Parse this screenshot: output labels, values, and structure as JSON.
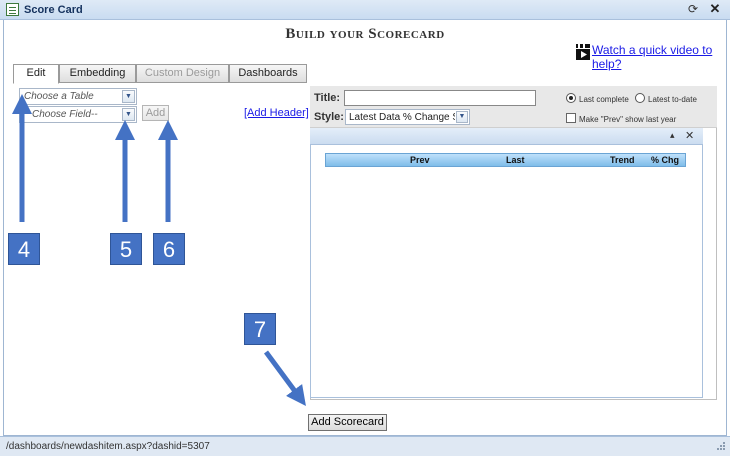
{
  "window": {
    "title": "Score Card",
    "refresh_icon": "refresh-icon",
    "close_icon": "close-icon"
  },
  "page": {
    "heading": "Build your Scorecard"
  },
  "help": {
    "video_link": "Watch a quick video to help?",
    "icon": "clapperboard-icon"
  },
  "tabs": [
    {
      "label": "Edit",
      "active": true,
      "disabled": false
    },
    {
      "label": "Embedding",
      "active": false,
      "disabled": false
    },
    {
      "label": "Custom Design",
      "active": false,
      "disabled": true
    },
    {
      "label": "Dashboards",
      "active": false,
      "disabled": false
    }
  ],
  "editor": {
    "table_placeholder": "Choose a Table",
    "field_placeholder": "Choose Field--",
    "add_label": "Add",
    "add_header_link": "[Add Header]"
  },
  "settings": {
    "title_label": "Title:",
    "title_value": "",
    "style_label": "Style:",
    "style_value": "Latest Data % Change Sc",
    "radio_last_complete": "Last complete",
    "radio_last_todate": "Latest to-date",
    "selected_radio": "Last complete",
    "checkbox_label": "Make \"Prev\" show last year",
    "checkbox_checked": false
  },
  "preview": {
    "minimize_glyph": "▴",
    "close_glyph": "✕",
    "columns": [
      "Prev",
      "Last",
      "Trend",
      "% Chg"
    ]
  },
  "actions": {
    "add_scorecard": "Add Scorecard"
  },
  "status": {
    "url": "/dashboards/newdashitem.aspx?dashid=5307"
  },
  "annotations": {
    "markers": [
      "4",
      "5",
      "6",
      "7"
    ],
    "color": "#4472c4"
  }
}
